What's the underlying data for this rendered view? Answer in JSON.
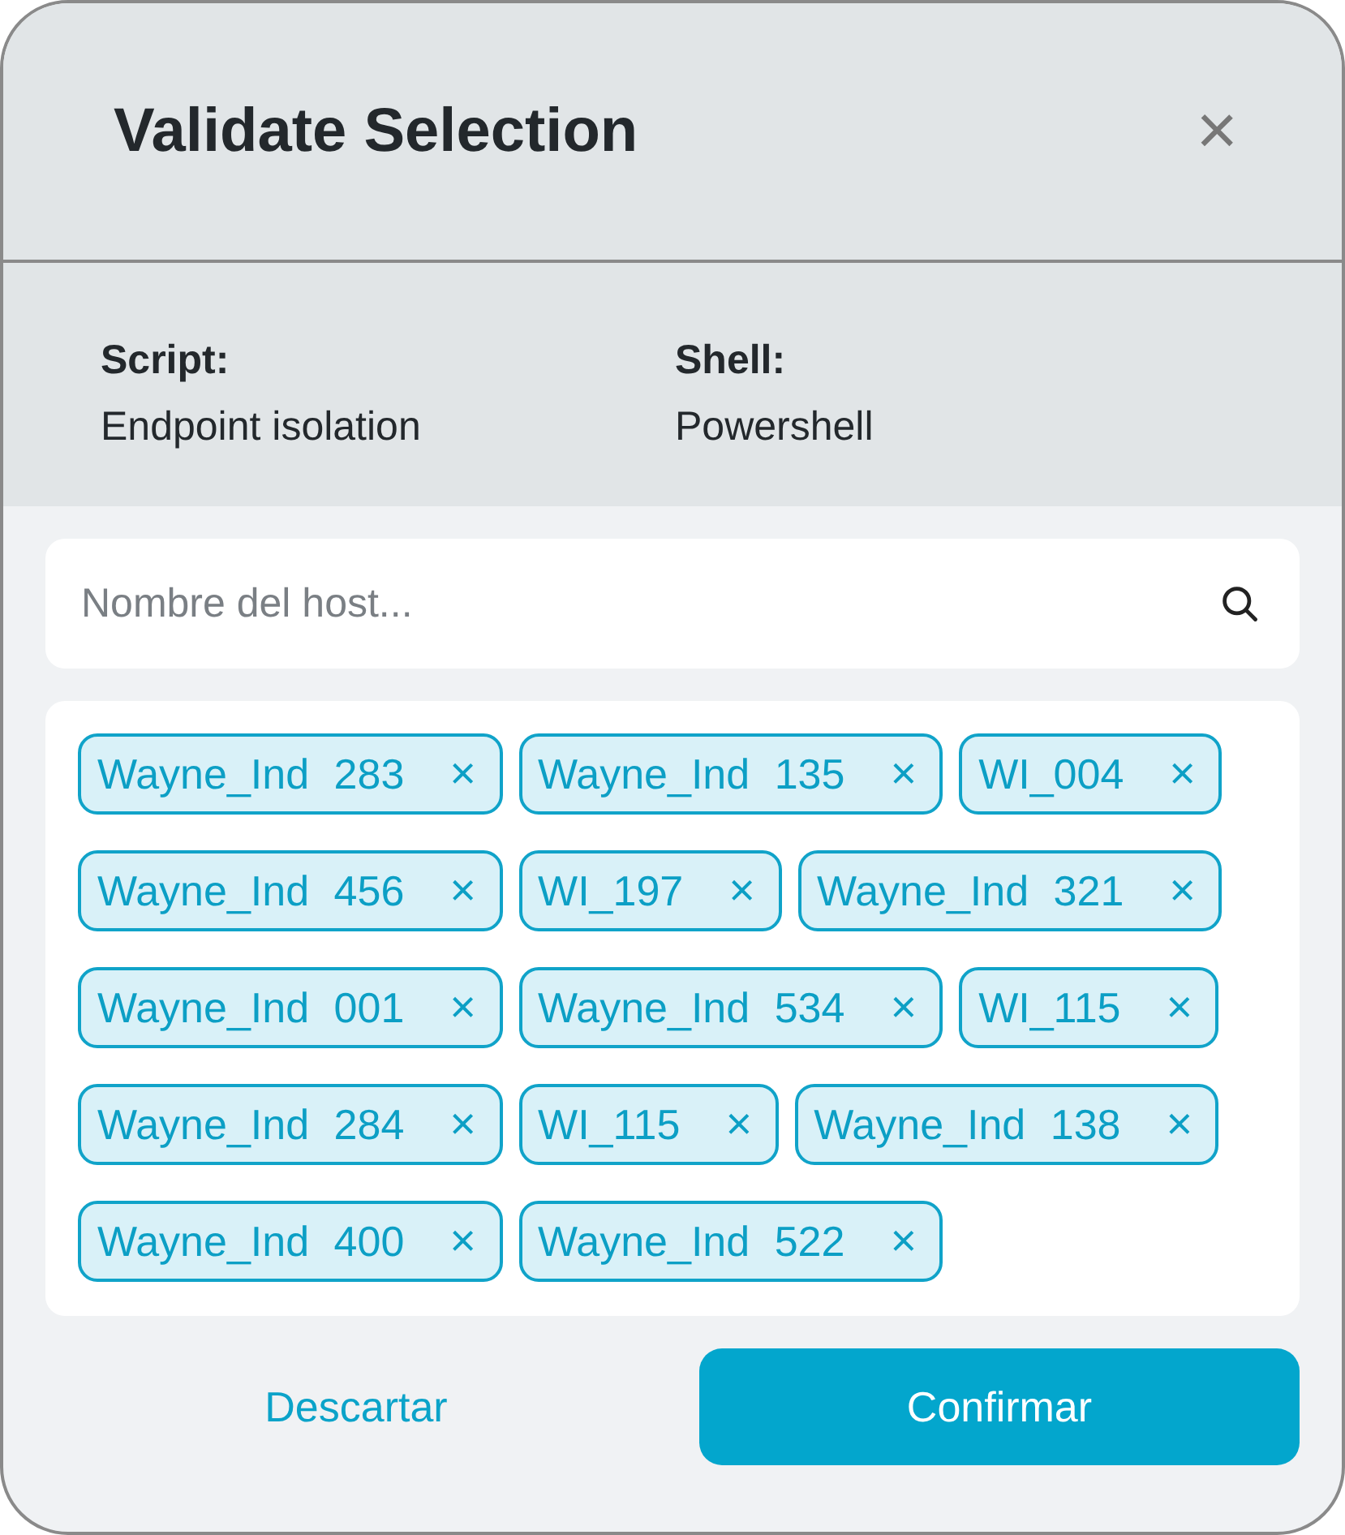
{
  "dialog": {
    "title": "Validate Selection",
    "close": "×"
  },
  "info": [
    {
      "label": "Script:",
      "value": "Endpoint isolation"
    },
    {
      "label": "Shell:",
      "value": "Powershell"
    }
  ],
  "search": {
    "placeholder": "Nombre del host..."
  },
  "tags": [
    {
      "label": "Wayne_Ind 283",
      "remove": "×"
    },
    {
      "label": "Wayne_Ind 135",
      "remove": "×"
    },
    {
      "label": "WI_004",
      "remove": "×"
    },
    {
      "label": "Wayne_Ind 456",
      "remove": "×"
    },
    {
      "label": "WI_197",
      "remove": "×"
    },
    {
      "label": "Wayne_Ind 321",
      "remove": "×"
    },
    {
      "label": "Wayne_Ind 001",
      "remove": "×"
    },
    {
      "label": "Wayne_Ind 534",
      "remove": "×"
    },
    {
      "label": "WI_115",
      "remove": "×"
    },
    {
      "label": "Wayne_Ind 284",
      "remove": "×"
    },
    {
      "label": "WI_115",
      "remove": "×"
    },
    {
      "label": "Wayne_Ind 138",
      "remove": "×"
    },
    {
      "label": "Wayne_Ind 400",
      "remove": "×"
    },
    {
      "label": "Wayne_Ind 522",
      "remove": "×"
    }
  ],
  "buttons": [
    {
      "label": "Descartar",
      "kind": "secondary"
    },
    {
      "label": "Confirmar",
      "kind": "primary"
    }
  ]
}
